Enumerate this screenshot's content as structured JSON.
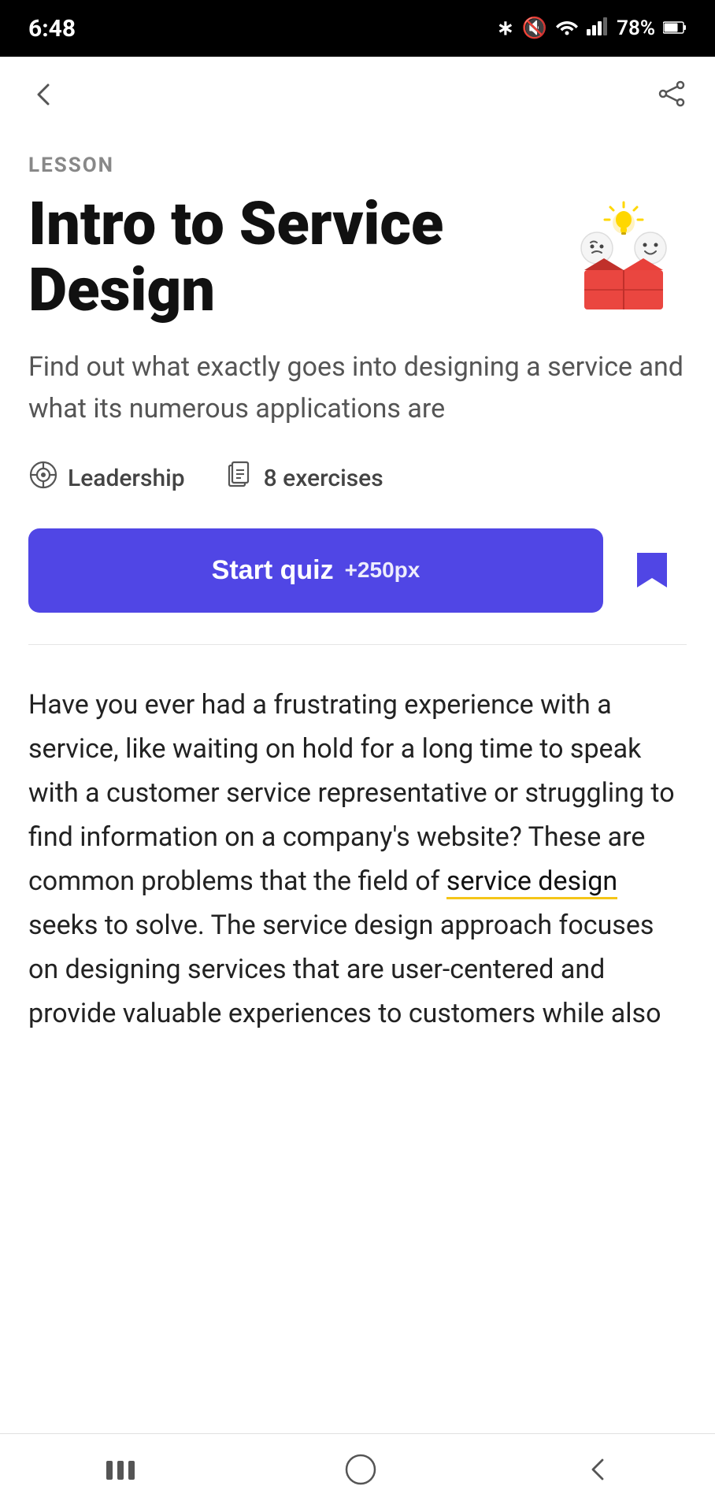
{
  "statusBar": {
    "time": "6:48",
    "battery": "78%",
    "icons": [
      "bluetooth",
      "mute",
      "wifi",
      "signal"
    ]
  },
  "nav": {
    "back_icon": "←",
    "share_icon": "share"
  },
  "lesson": {
    "label": "LESSON",
    "title": "Intro to Service Design",
    "description": "Find out what exactly goes into designing a service and what its numerous applications are",
    "category": "Leadership",
    "exercises_count": "8 exercises",
    "start_quiz_label": "Start quiz",
    "start_quiz_xp": "+250px",
    "bookmark_icon": "bookmark"
  },
  "article": {
    "paragraph1": "Have you ever had a frustrating experience with a service, like waiting on hold for a long time to speak with a customer service representative or struggling to find information on a company's website? These are common problems that the field of ",
    "highlight_text": "service design",
    "paragraph2": " seeks to solve. The service design approach focuses on designing services that are user-centered and provide valuable experiences to customers while also"
  },
  "bottomNav": {
    "menu_icon": "|||",
    "home_icon": "○",
    "back_icon": "<"
  }
}
